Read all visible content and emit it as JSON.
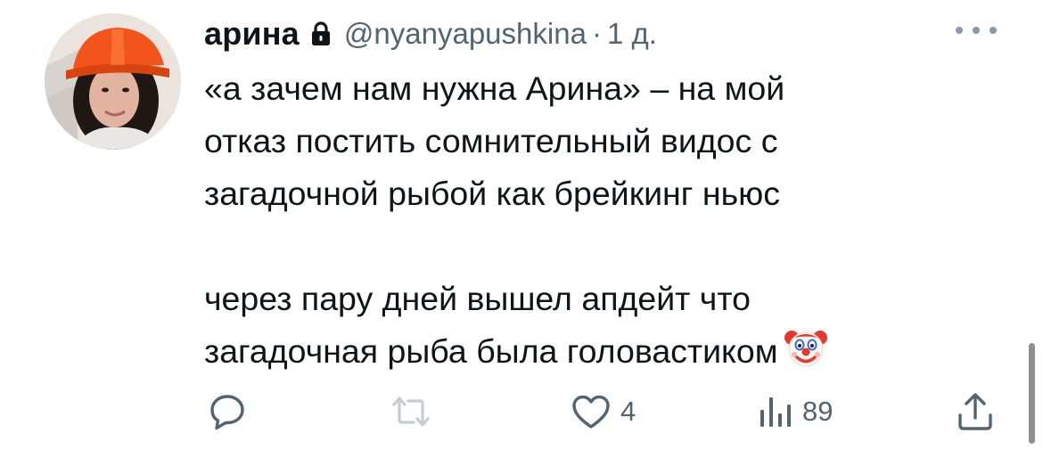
{
  "tweet": {
    "author_name": "арина",
    "handle": "@nyanyapushkina",
    "separator": "·",
    "time": "1 д.",
    "text_lines": [
      "«а зачем нам нужна Арина» – на мой",
      "отказ постить сомнительный видос с",
      "загадочной рыбой как брейкинг ньюс",
      "",
      "через пару дней вышел апдейт что",
      "загадочная рыба была головастиком"
    ],
    "emoji": "clown-face"
  },
  "actions": {
    "reply_icon": "speech-bubble-icon",
    "retweet_icon": "retweet-icon",
    "like_icon": "heart-icon",
    "like_count": "4",
    "views_icon": "bar-chart-icon",
    "views_count": "89",
    "share_icon": "share-icon"
  },
  "colors": {
    "text": "#0f1419",
    "secondary": "#536471",
    "background": "#ffffff"
  }
}
